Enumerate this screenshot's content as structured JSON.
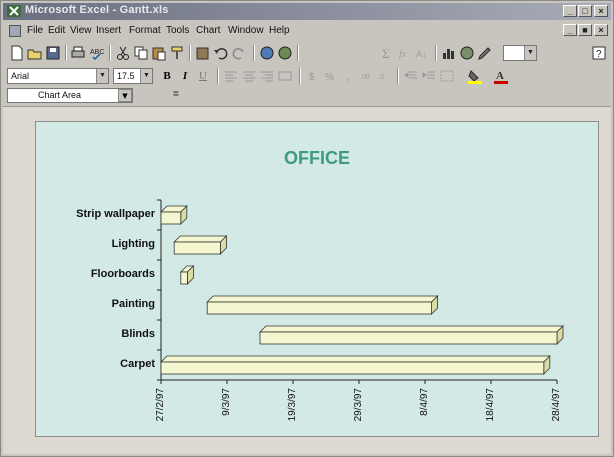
{
  "window": {
    "title": "Microsoft Excel - Gantt.xls",
    "controls": [
      "_",
      "□",
      "×"
    ],
    "doc_controls": [
      "_",
      "■",
      "×"
    ]
  },
  "menu": [
    "File",
    "Edit",
    "View",
    "Insert",
    "Format",
    "Tools",
    "Chart",
    "Window",
    "Help"
  ],
  "formatting": {
    "font_name": "Arial",
    "font_size": "17.5",
    "bold": "B",
    "italic": "I",
    "underline": "U"
  },
  "name_box": "Chart Area",
  "equals": "=",
  "chart_data": {
    "type": "bar",
    "orientation": "horizontal",
    "subtype": "gantt",
    "title": "OFFICE",
    "categories": [
      "Carpet",
      "Blinds",
      "Painting",
      "Floorboards",
      "Lighting",
      "Strip wallpaper"
    ],
    "series": [
      {
        "name": "",
        "start": [
          "27/2/97",
          "14/3/97",
          "6/3/97",
          "2/3/97",
          "1/3/97",
          "27/2/97"
        ],
        "end": [
          "26/4/97",
          "28/4/97",
          "9/4/97",
          "3/3/97",
          "8/3/97",
          "2/3/97"
        ]
      }
    ],
    "x_ticks": [
      "27/2/97",
      "9/3/97",
      "19/3/97",
      "29/3/97",
      "8/4/97",
      "18/4/97",
      "28/4/97"
    ],
    "xlim": [
      "27/2/97",
      "28/4/97"
    ],
    "colors": {
      "bar_fill": "#f4f6cf",
      "bar_side": "#d8dca5",
      "chart_bg": "#d2e9e6",
      "title": "#3f9b7f"
    },
    "legend": "none",
    "grid": false
  }
}
